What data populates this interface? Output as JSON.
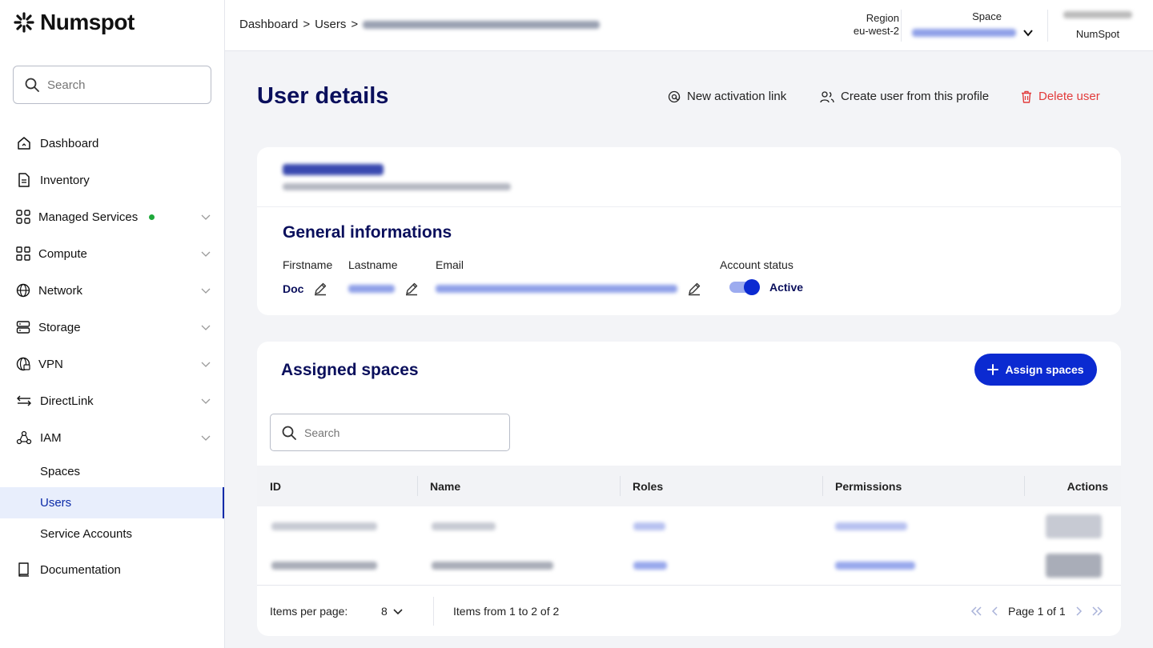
{
  "app": {
    "logo": "Numspot"
  },
  "sidebar": {
    "search_placeholder": "Search",
    "items": [
      {
        "label": "Dashboard",
        "icon": "home-icon"
      },
      {
        "label": "Inventory",
        "icon": "document-icon"
      },
      {
        "label": "Managed Services",
        "icon": "apps-icon",
        "status_dot": "#1ea83a"
      },
      {
        "label": "Compute",
        "icon": "grid-icon"
      },
      {
        "label": "Network",
        "icon": "globe-icon"
      },
      {
        "label": "Storage",
        "icon": "storage-icon"
      },
      {
        "label": "VPN",
        "icon": "vpn-icon"
      },
      {
        "label": "DirectLink",
        "icon": "directlink-icon"
      },
      {
        "label": "IAM",
        "icon": "iam-icon"
      }
    ],
    "iam_sub": [
      "Spaces",
      "Users",
      "Service Accounts"
    ],
    "documentation": "Documentation"
  },
  "topbar": {
    "breadcrumb": [
      "Dashboard",
      "Users"
    ],
    "region_label": "Region",
    "region_value": "eu-west-2",
    "space_label": "Space",
    "org_name": "NumSpot"
  },
  "page": {
    "title": "User details",
    "actions": {
      "new_activation": "New activation link",
      "create_from_profile": "Create user from this profile",
      "delete": "Delete user"
    }
  },
  "general": {
    "title": "General informations",
    "firstname_label": "Firstname",
    "firstname_value": "Doc",
    "lastname_label": "Lastname",
    "email_label": "Email",
    "status_label": "Account status",
    "status_value": "Active"
  },
  "assigned": {
    "title": "Assigned spaces",
    "assign_button": "Assign spaces",
    "search_placeholder": "Search",
    "columns": [
      "ID",
      "Name",
      "Roles",
      "Permissions",
      "Actions"
    ],
    "footer": {
      "items_per_page_label": "Items per page:",
      "items_per_page_value": "8",
      "range": "Items from 1 to 2 of 2",
      "page": "Page 1 of 1"
    }
  },
  "colors": {
    "primary": "#0b2ad1",
    "title": "#0a0f5c",
    "danger": "#e23b3b"
  }
}
